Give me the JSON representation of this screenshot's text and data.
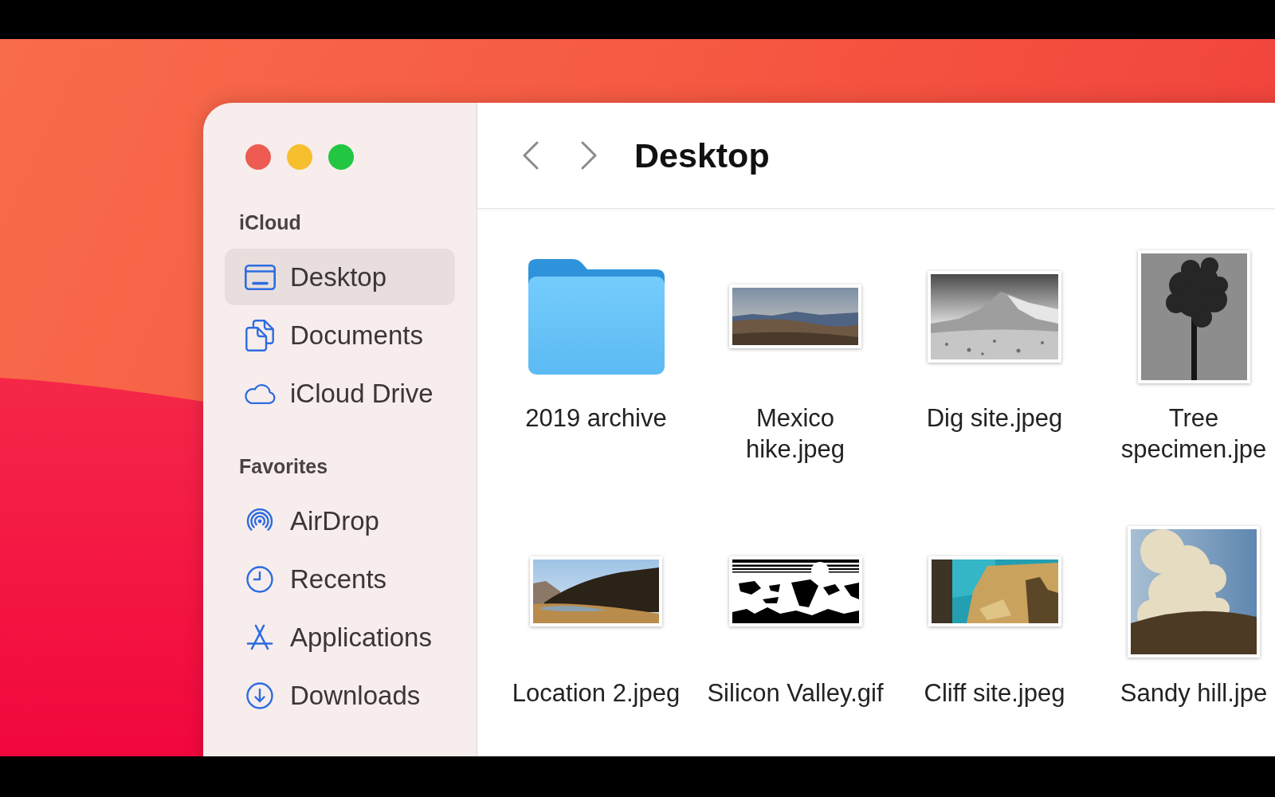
{
  "window": {
    "title": "Desktop"
  },
  "sidebar": {
    "sections": [
      {
        "title": "iCloud",
        "items": [
          {
            "label": "Desktop",
            "selected": true
          },
          {
            "label": "Documents",
            "selected": false
          },
          {
            "label": "iCloud Drive",
            "selected": false
          }
        ]
      },
      {
        "title": "Favorites",
        "items": [
          {
            "label": "AirDrop",
            "selected": false
          },
          {
            "label": "Recents",
            "selected": false
          },
          {
            "label": "Applications",
            "selected": false
          },
          {
            "label": "Downloads",
            "selected": false
          }
        ]
      }
    ]
  },
  "files": [
    {
      "name": "2019 archive",
      "kind": "folder"
    },
    {
      "name": "Mexico hike.jpeg",
      "kind": "image"
    },
    {
      "name": "Dig site.jpeg",
      "kind": "image"
    },
    {
      "name": "Tree specimen.jpe",
      "kind": "image"
    },
    {
      "name": "Location 2.jpeg",
      "kind": "image"
    },
    {
      "name": "Silicon Valley.gif",
      "kind": "image"
    },
    {
      "name": "Cliff site.jpeg",
      "kind": "image"
    },
    {
      "name": "Sandy hill.jpe",
      "kind": "image"
    }
  ]
}
